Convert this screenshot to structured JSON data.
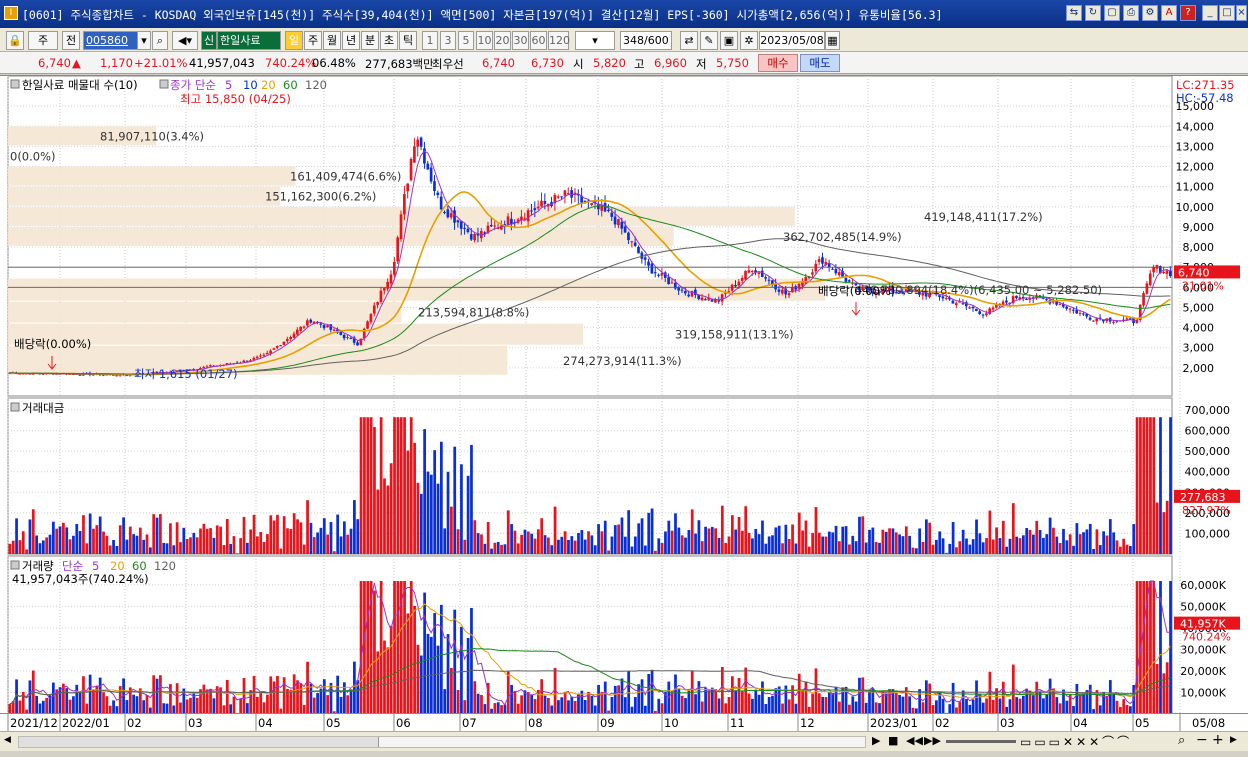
{
  "window": {
    "title": "[0601] 주식종합차트 - KOSDAQ 외국인보유[145(천)] 주식수[39,404(천)] 액면[500] 자본금[197(억)] 결산[12월] EPS[-360] 시가총액[2,656(억)] 유통비율[56.3]",
    "help_icon": "?"
  },
  "toolbar": {
    "market": "주",
    "prev_label": "전",
    "code": "005860",
    "stock_name": "한일사료",
    "new_badge": "신",
    "period_tabs": [
      "일",
      "주",
      "월",
      "년",
      "분",
      "초",
      "틱"
    ],
    "interval_buttons": [
      "1",
      "3",
      "5",
      "10",
      "20",
      "30",
      "60",
      "120"
    ],
    "count": "348",
    "count_total": "/600",
    "date": "2023/05/08"
  },
  "quote": {
    "price": "6,740",
    "change": "1,170",
    "change_pct": "+21.01%",
    "volume": "41,957,043",
    "volume_pct": "740.24%",
    "turnover_pct": "06.48%",
    "value": "277,683백만",
    "best_ask_label": "최우선",
    "best_ask": "6,740",
    "best_bid": "6,730",
    "open_label": "시",
    "open": "5,820",
    "high_label": "고",
    "high": "6,960",
    "low_label": "저",
    "low": "5,750",
    "buy_button": "매수",
    "sell_button": "매도"
  },
  "colors": {
    "up": "#e8141b",
    "down": "#0b2fd6",
    "ma5": "#9933cc",
    "ma10": "#0033cc",
    "ma20": "#e8a000",
    "ma60": "#1a8a1a",
    "ma120": "#606060",
    "band": "#f5e6d3"
  },
  "price_panel": {
    "legend_title": "한일사료 매물대 수(10)",
    "legend_ma_label": "종가 단순",
    "legend_ma": [
      "5",
      "10",
      "20",
      "60",
      "120"
    ],
    "lc": "LC:271.35",
    "hc": "HC:-57.48",
    "current_price_tag": "6,740",
    "current_pct_tag": "21.01%",
    "high_annotation": "최고 15,850 (04/25)",
    "low_annotation": "최저 1,615 (01/27)",
    "dividend_label_1": "배당락(0.00%)",
    "dividend_label_2": "배당락(0.00%)",
    "volume_profile": [
      {
        "label": "81,907,110(3.4%)",
        "price_low": 13000,
        "price_high": 14000,
        "fraction": 0.049
      },
      {
        "label": "0(0.0%)",
        "price_low": 12000,
        "price_high": 13000,
        "fraction": 0.0
      },
      {
        "label": "161,409,474(6.6%)",
        "price_low": 11000,
        "price_high": 12000,
        "fraction": 0.095
      },
      {
        "label": "419,148,411(17.2%)",
        "price_low": 9000,
        "price_high": 10000,
        "fraction": 0.26
      },
      {
        "label": "151,162,300(6.2%)",
        "price_low": 10000,
        "price_high": 11000,
        "fraction": 0.09
      },
      {
        "label": "362,702,485(14.9%)",
        "price_low": 8000,
        "price_high": 9000,
        "fraction": 0.22
      },
      {
        "label": "446,780,894(18.4%)(6,435.00 ~ 5,282.50)",
        "price_low": 5282,
        "price_high": 6435,
        "fraction": 0.27
      },
      {
        "label": "213,594,811(8.8%)",
        "price_low": 4200,
        "price_high": 5282,
        "fraction": 0.13
      },
      {
        "label": "319,158,911(13.1%)",
        "price_low": 3100,
        "price_high": 4200,
        "fraction": 0.19
      },
      {
        "label": "274,273,914(11.3%)",
        "price_low": 1600,
        "price_high": 3100,
        "fraction": 0.165
      }
    ],
    "y_ticks": [
      "15,000",
      "14,000",
      "13,000",
      "12,000",
      "11,000",
      "10,000",
      "9,000",
      "8,000",
      "7,000",
      "6,000",
      "5,000",
      "4,000",
      "3,000",
      "2,000"
    ]
  },
  "value_panel": {
    "title": "거래대금",
    "y_ticks": [
      "700,000",
      "600,000",
      "500,000",
      "400,000",
      "300,000",
      "200,000",
      "100,000"
    ],
    "current_tag": "277,683",
    "pct_tag": "827.97%"
  },
  "volume_panel": {
    "title": "거래량",
    "legend_ma_label": "단순",
    "legend_ma": [
      "5",
      "20",
      "60",
      "120"
    ],
    "subtitle": "41,957,043주(740.24%)",
    "y_ticks": [
      "60,000K",
      "50,000K",
      "40,000K",
      "30,000K",
      "20,000K",
      "10,000K"
    ],
    "current_tag": "41,957K",
    "pct_tag": "740.24%"
  },
  "x_axis_labels": [
    "2021/12",
    "2022/01",
    "02",
    "03",
    "04",
    "05",
    "06",
    "07",
    "08",
    "09",
    "10",
    "11",
    "12",
    "2023/01",
    "02",
    "03",
    "04",
    "05",
    "05/08"
  ],
  "chart_data": {
    "type": "candlestick",
    "x_range": [
      "2021/12",
      "2023/05/08"
    ],
    "ylim": [
      1000,
      16000
    ],
    "price_anchors": [
      {
        "t": 0.0,
        "close": 1750
      },
      {
        "t": 0.1,
        "close": 1650
      },
      {
        "t": 0.14,
        "close": 1800
      },
      {
        "t": 0.2,
        "close": 2300
      },
      {
        "t": 0.22,
        "close": 2600
      },
      {
        "t": 0.26,
        "close": 4400
      },
      {
        "t": 0.3,
        "close": 3200
      },
      {
        "t": 0.33,
        "close": 7000
      },
      {
        "t": 0.35,
        "close": 13800
      },
      {
        "t": 0.37,
        "close": 10200
      },
      {
        "t": 0.4,
        "close": 8500
      },
      {
        "t": 0.44,
        "close": 9600
      },
      {
        "t": 0.48,
        "close": 10600
      },
      {
        "t": 0.52,
        "close": 9500
      },
      {
        "t": 0.55,
        "close": 7000
      },
      {
        "t": 0.58,
        "close": 5800
      },
      {
        "t": 0.61,
        "close": 5300
      },
      {
        "t": 0.64,
        "close": 7000
      },
      {
        "t": 0.67,
        "close": 5600
      },
      {
        "t": 0.7,
        "close": 7400
      },
      {
        "t": 0.73,
        "close": 5900
      },
      {
        "t": 0.77,
        "close": 5800
      },
      {
        "t": 0.8,
        "close": 5600
      },
      {
        "t": 0.84,
        "close": 4700
      },
      {
        "t": 0.87,
        "close": 5600
      },
      {
        "t": 0.9,
        "close": 5300
      },
      {
        "t": 0.93,
        "close": 4500
      },
      {
        "t": 0.97,
        "close": 4300
      },
      {
        "t": 0.985,
        "close": 7000
      },
      {
        "t": 1.0,
        "close": 6740
      }
    ],
    "value_max": 700000,
    "volume_max_k": 65000
  }
}
